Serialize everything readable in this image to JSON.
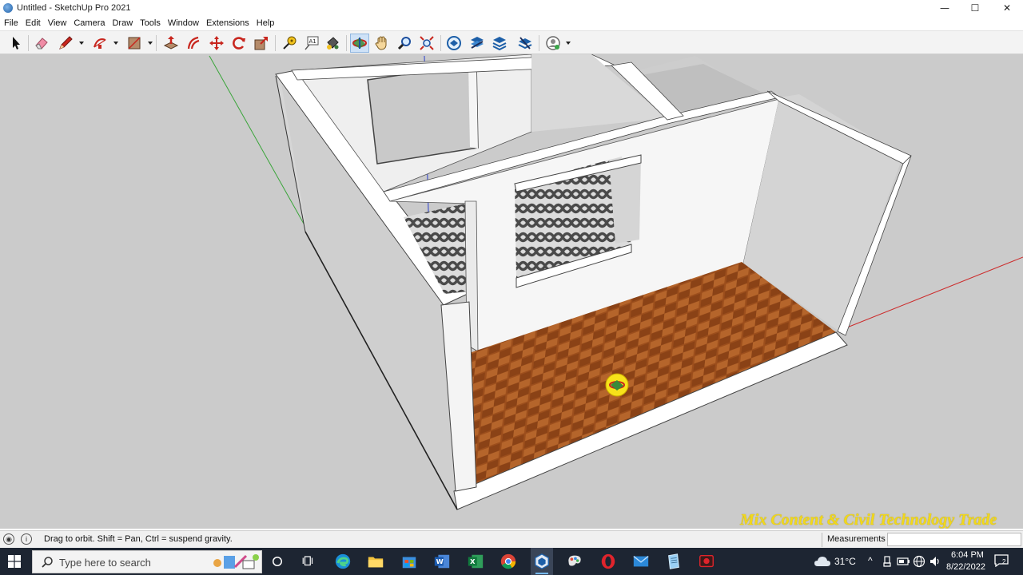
{
  "window": {
    "title": "Untitled - SketchUp Pro 2021",
    "controls": {
      "minimize": "—",
      "maximize": "☐",
      "close": "✕"
    }
  },
  "menu": [
    "File",
    "Edit",
    "View",
    "Camera",
    "Draw",
    "Tools",
    "Window",
    "Extensions",
    "Help"
  ],
  "toolbar": {
    "tools": [
      {
        "name": "select-icon",
        "active": false
      },
      {
        "name": "eraser-icon",
        "active": false
      },
      {
        "name": "line-pencil-icon",
        "active": false,
        "dropdown": true
      },
      {
        "name": "arc-icon",
        "active": false,
        "dropdown": true
      },
      {
        "name": "rectangle-icon",
        "active": false,
        "dropdown": true
      },
      {
        "name": "push-pull-icon",
        "active": false
      },
      {
        "name": "offset-icon",
        "active": false
      },
      {
        "name": "move-icon",
        "active": false
      },
      {
        "name": "rotate-icon",
        "active": false
      },
      {
        "name": "scale-icon",
        "active": false
      },
      {
        "name": "tape-measure-icon",
        "active": false
      },
      {
        "name": "text-icon",
        "active": false
      },
      {
        "name": "paint-bucket-icon",
        "active": false
      },
      {
        "name": "orbit-icon",
        "active": true
      },
      {
        "name": "pan-icon",
        "active": false
      },
      {
        "name": "zoom-icon",
        "active": false
      },
      {
        "name": "zoom-extents-icon",
        "active": false
      },
      {
        "name": "3d-warehouse-icon",
        "active": false
      },
      {
        "name": "extension-warehouse-icon",
        "active": false
      },
      {
        "name": "layout-icon",
        "active": false
      },
      {
        "name": "extension-manager-icon",
        "active": false
      },
      {
        "name": "account-icon",
        "active": false,
        "dropdown": true
      }
    ],
    "text_tool_label": "A1"
  },
  "viewport": {
    "watermark": "Mix Content & Civil Technology Trade",
    "colors": {
      "background": "#cbcbcb",
      "wall": "#f4f4f4",
      "wall_shade": "#d2d2d2",
      "floor": "#9c4e1c"
    }
  },
  "status": {
    "hint": "Drag to orbit. Shift = Pan, Ctrl = suspend gravity.",
    "measurements_label": "Measurements",
    "measurements_value": ""
  },
  "taskbar": {
    "search_placeholder": "Type here to search",
    "apps": [
      "cortana-icon",
      "task-view-icon",
      "edge-icon",
      "file-explorer-icon",
      "store-icon",
      "word-icon",
      "excel-icon",
      "chrome-icon",
      "sketchup-icon",
      "paint-icon",
      "opera-icon",
      "mail-icon",
      "notepad-icon",
      "recorder-icon"
    ],
    "weather": "31°C",
    "time": "6:04 PM",
    "date": "8/22/2022",
    "notifications": "2"
  }
}
